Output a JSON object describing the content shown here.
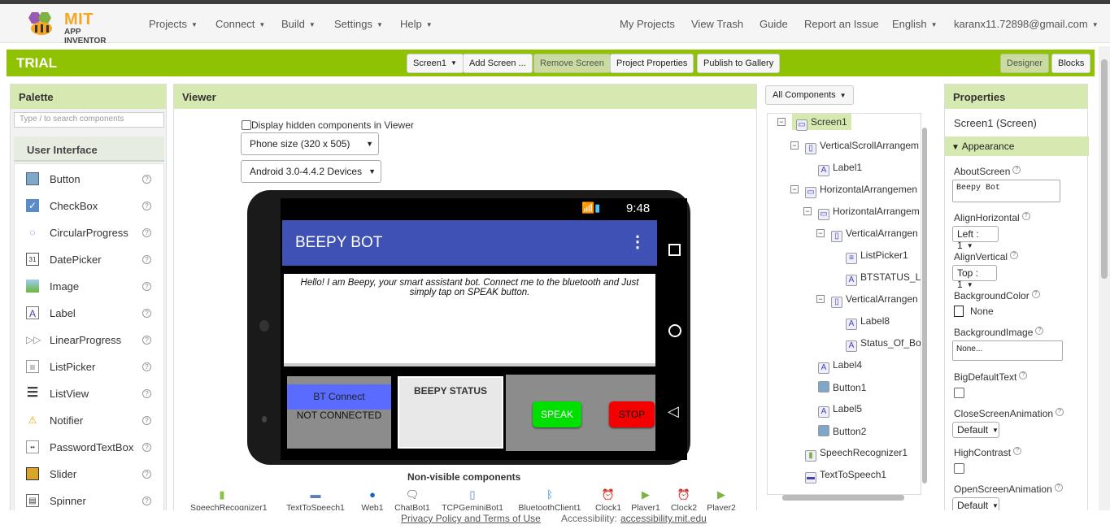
{
  "app": {
    "logo_title": "MIT",
    "logo_subtitle": "APP INVENTOR"
  },
  "nav": {
    "left": [
      "Projects",
      "Connect",
      "Build",
      "Settings",
      "Help"
    ],
    "my_projects": "My Projects",
    "view_trash": "View Trash",
    "guide": "Guide",
    "report": "Report an Issue",
    "language": "English",
    "account": "karanx11.72898@gmail.com"
  },
  "toolbar": {
    "project_name": "TRIAL",
    "screen": "Screen1",
    "add_screen": "Add Screen ...",
    "remove_screen": "Remove Screen",
    "project_properties": "Project Properties",
    "publish": "Publish to Gallery",
    "designer": "Designer",
    "blocks": "Blocks"
  },
  "palette": {
    "title": "Palette",
    "search_placeholder": "Type / to search components",
    "category": "User Interface",
    "items": [
      {
        "name": "Button",
        "icon": "button-icon"
      },
      {
        "name": "CheckBox",
        "icon": "checkbox-icon"
      },
      {
        "name": "CircularProgress",
        "icon": "circular-progress-icon"
      },
      {
        "name": "DatePicker",
        "icon": "datepicker-icon"
      },
      {
        "name": "Image",
        "icon": "image-icon"
      },
      {
        "name": "Label",
        "icon": "label-icon"
      },
      {
        "name": "LinearProgress",
        "icon": "linear-progress-icon"
      },
      {
        "name": "ListPicker",
        "icon": "listpicker-icon"
      },
      {
        "name": "ListView",
        "icon": "listview-icon"
      },
      {
        "name": "Notifier",
        "icon": "notifier-icon"
      },
      {
        "name": "PasswordTextBox",
        "icon": "password-icon"
      },
      {
        "name": "Slider",
        "icon": "slider-icon"
      },
      {
        "name": "Spinner",
        "icon": "spinner-icon"
      }
    ]
  },
  "viewer": {
    "title": "Viewer",
    "display_hidden": "Display hidden components in Viewer",
    "size_select": "Phone size (320 x 505)",
    "android_select": "Android 3.0-4.4.2 Devices",
    "phone": {
      "time": "9:48",
      "app_title": "BEEPY BOT",
      "greeting": "Hello! I am Beepy, your smart assistant bot. Connect me to the bluetooth and Just simply tap on SPEAK button.",
      "bt_connect": "BT Connect",
      "not_connected": "NOT CONNECTED",
      "beepy_status": "BEEPY STATUS",
      "speak": "SPEAK",
      "stop": "STOP"
    },
    "nonvisible_title": "Non-visible components",
    "nonvisible": [
      "SpeechRecognizer1",
      "TextToSpeech1",
      "Web1",
      "ChatBot1",
      "TCPGeminiBot1",
      "BluetoothClient1",
      "Clock1",
      "Player1",
      "Clock2",
      "Player2"
    ]
  },
  "components": {
    "filter": "All Components",
    "tree": [
      {
        "label": "Screen1",
        "icon": "screen-icon"
      },
      {
        "label": "VerticalScrollArrangem",
        "icon": "vertical-arrangement-icon"
      },
      {
        "label": "Label1",
        "icon": "label-icon"
      },
      {
        "label": "HorizontalArrangemen",
        "icon": "horizontal-arrangement-icon"
      },
      {
        "label": "HorizontalArrangem",
        "icon": "horizontal-arrangement-icon"
      },
      {
        "label": "VerticalArrangen",
        "icon": "vertical-arrangement-icon"
      },
      {
        "label": "ListPicker1",
        "icon": "listpicker-icon"
      },
      {
        "label": "BTSTATUS_LA",
        "icon": "label-icon"
      },
      {
        "label": "VerticalArrangen",
        "icon": "vertical-arrangement-icon"
      },
      {
        "label": "Label8",
        "icon": "label-icon"
      },
      {
        "label": "Status_Of_Bo",
        "icon": "label-icon"
      },
      {
        "label": "Label4",
        "icon": "label-icon"
      },
      {
        "label": "Button1",
        "icon": "button-icon"
      },
      {
        "label": "Label5",
        "icon": "label-icon"
      },
      {
        "label": "Button2",
        "icon": "button-icon"
      },
      {
        "label": "SpeechRecognizer1",
        "icon": "speech-recognizer-icon"
      },
      {
        "label": "TextToSpeech1",
        "icon": "text-to-speech-icon"
      }
    ]
  },
  "properties": {
    "title": "Properties",
    "subject": "Screen1 (Screen)",
    "section": "Appearance",
    "about_label": "AboutScreen",
    "about_value": "Beepy Bot",
    "align_h_label": "AlignHorizontal",
    "align_h_value": "Left : 1",
    "align_v_label": "AlignVertical",
    "align_v_value": "Top : 1",
    "bgcolor_label": "BackgroundColor",
    "bgcolor_value": "None",
    "bgimage_label": "BackgroundImage",
    "bgimage_value": "None...",
    "bigtext_label": "BigDefaultText",
    "closeanim_label": "CloseScreenAnimation",
    "closeanim_value": "Default",
    "contrast_label": "HighContrast",
    "openanim_label": "OpenScreenAnimation",
    "openanim_value": "Default"
  },
  "footer": {
    "privacy": "Privacy Policy and Terms of Use",
    "accessibility_label": "Accessibility:",
    "accessibility_link": "accessibility.mit.edu"
  },
  "colors": {
    "accent": "#8fc202",
    "panel_header": "#d6e9b0",
    "appbar": "#3f51b5"
  }
}
